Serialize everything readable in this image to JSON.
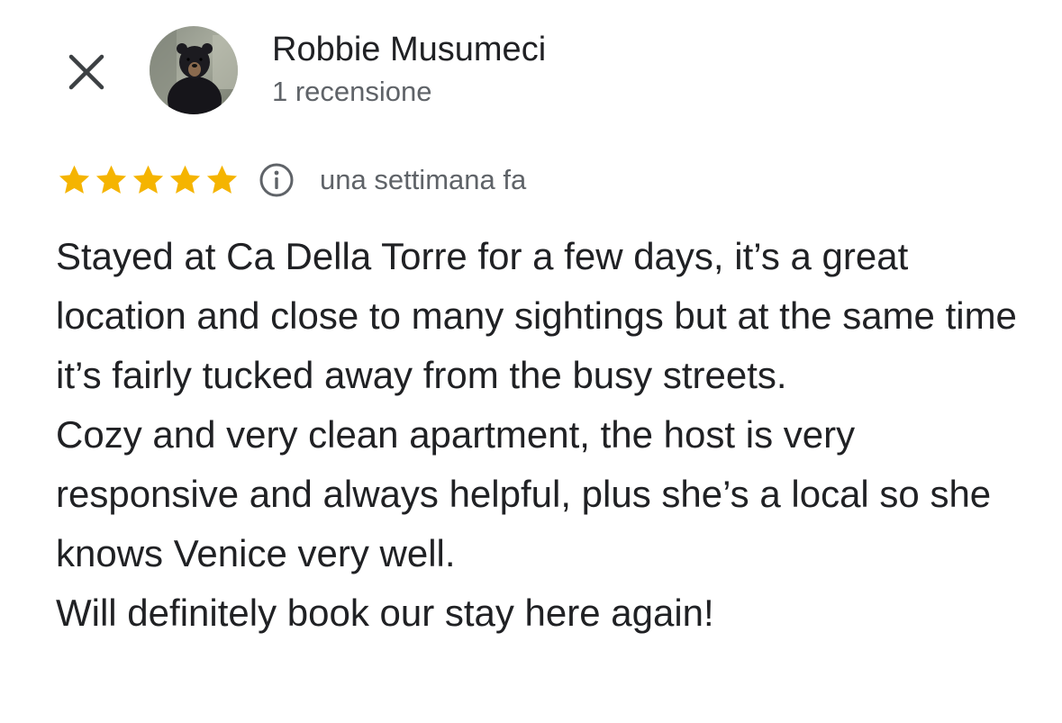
{
  "header": {
    "close_icon": "close-icon",
    "avatar_icon": "black-bear-avatar",
    "author_name": "Robbie Musumeci",
    "author_review_count": "1 recensione"
  },
  "review": {
    "rating": 5,
    "rating_max": 5,
    "star_color": "#f5b400",
    "info_icon": "info-icon",
    "date": "una settimana fa",
    "paragraphs": [
      "Stayed at Ca Della Torre for a few days, it’s a great location and close to many sightings but at the same time it’s fairly tucked away from the busy streets.",
      "Cozy and very clean apartment, the host is very responsive and always helpful, plus she’s a local so she knows Venice very well.",
      "Will definitely book our stay here again!"
    ]
  }
}
